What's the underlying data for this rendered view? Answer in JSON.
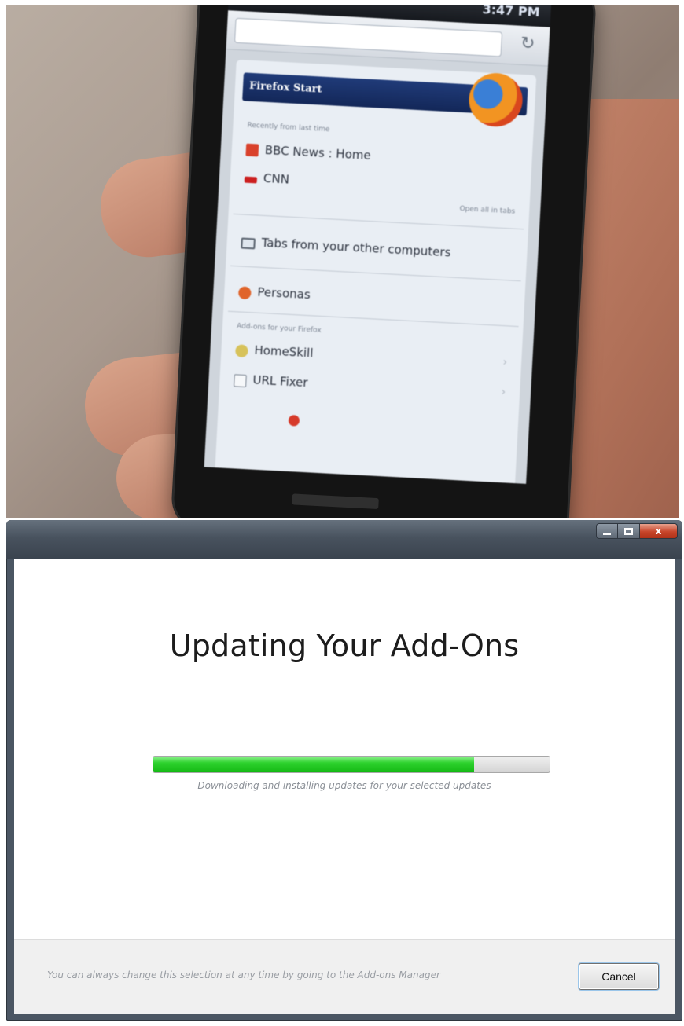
{
  "photo": {
    "phone": {
      "status_time": "3:47 PM",
      "header_text": "Firefox Start",
      "recent_label": "Recently from last time",
      "recent_items": [
        {
          "label": "BBC News : Home",
          "icon_color": "#d9412b"
        },
        {
          "label": "CNN",
          "icon_color": "#cc1f1f"
        }
      ],
      "open_all_label": "Open all in tabs",
      "tabs_label": "Tabs from your other computers",
      "personas_label": "Personas",
      "addons_label": "Add-ons for your Firefox",
      "addon_items": [
        {
          "label": "HomeSkill"
        },
        {
          "label": "URL Fixer"
        }
      ]
    }
  },
  "dialog": {
    "title": "Updating Your Add-Ons",
    "progress": {
      "fraction": 0.81,
      "caption": "Downloading and installing updates for your selected updates",
      "fill_color": "#2ed22e"
    },
    "footer_text": "You can always change this selection at any time by going to the Add-ons Manager",
    "cancel_label": "Cancel",
    "caption_buttons": {
      "close_glyph": "x"
    }
  }
}
